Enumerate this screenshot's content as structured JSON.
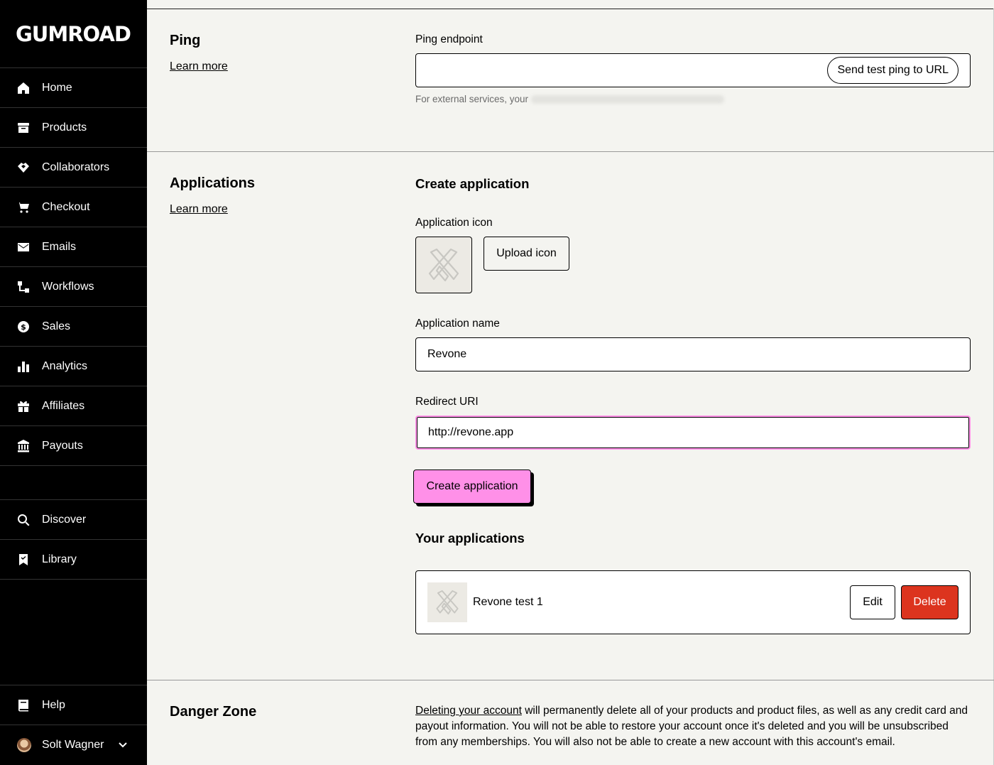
{
  "brand": {
    "logo_text": "GUMROAD"
  },
  "sidebar": {
    "items": [
      {
        "label": "Home",
        "icon": "home-icon"
      },
      {
        "label": "Products",
        "icon": "archive-icon"
      },
      {
        "label": "Collaborators",
        "icon": "handshake-icon"
      },
      {
        "label": "Checkout",
        "icon": "cart-icon"
      },
      {
        "label": "Emails",
        "icon": "envelope-icon"
      },
      {
        "label": "Workflows",
        "icon": "workflow-icon"
      },
      {
        "label": "Sales",
        "icon": "dollar-circle-icon"
      },
      {
        "label": "Analytics",
        "icon": "bar-chart-icon"
      },
      {
        "label": "Affiliates",
        "icon": "gift-icon"
      },
      {
        "label": "Payouts",
        "icon": "bank-icon"
      }
    ],
    "secondary": [
      {
        "label": "Discover",
        "icon": "search-icon"
      },
      {
        "label": "Library",
        "icon": "bookmark-icon"
      }
    ],
    "help": {
      "label": "Help",
      "icon": "book-icon"
    },
    "user": {
      "name": "Solt Wagner",
      "icon": "chevron-down-icon"
    }
  },
  "ping": {
    "title": "Ping",
    "learn_more": "Learn more",
    "endpoint_label": "Ping endpoint",
    "endpoint_value": "",
    "send_test_button": "Send test ping to URL",
    "hint": "For external services, your"
  },
  "applications": {
    "title": "Applications",
    "learn_more": "Learn more",
    "create_heading": "Create application",
    "icon_label": "Application icon",
    "upload_button": "Upload icon",
    "name_label": "Application name",
    "name_value": "Revone",
    "redirect_label": "Redirect URI",
    "redirect_value": "http://revone.app",
    "create_button": "Create application",
    "your_apps_heading": "Your applications",
    "list": [
      {
        "name": "Revone test 1",
        "edit": "Edit",
        "delete": "Delete"
      }
    ]
  },
  "danger": {
    "title": "Danger Zone",
    "link": "Deleting your account",
    "text": " will permanently delete all of your products and product files, as well as any credit card and payout information. You will not be able to restore your account once it's deleted and you will be unsubscribed from any memberships. You will also not be able to create a new account with this account's email."
  },
  "colors": {
    "accent": "#ff90e8",
    "danger": "#dc341e",
    "background": "#f4f4f0",
    "sidebar": "#000000"
  }
}
